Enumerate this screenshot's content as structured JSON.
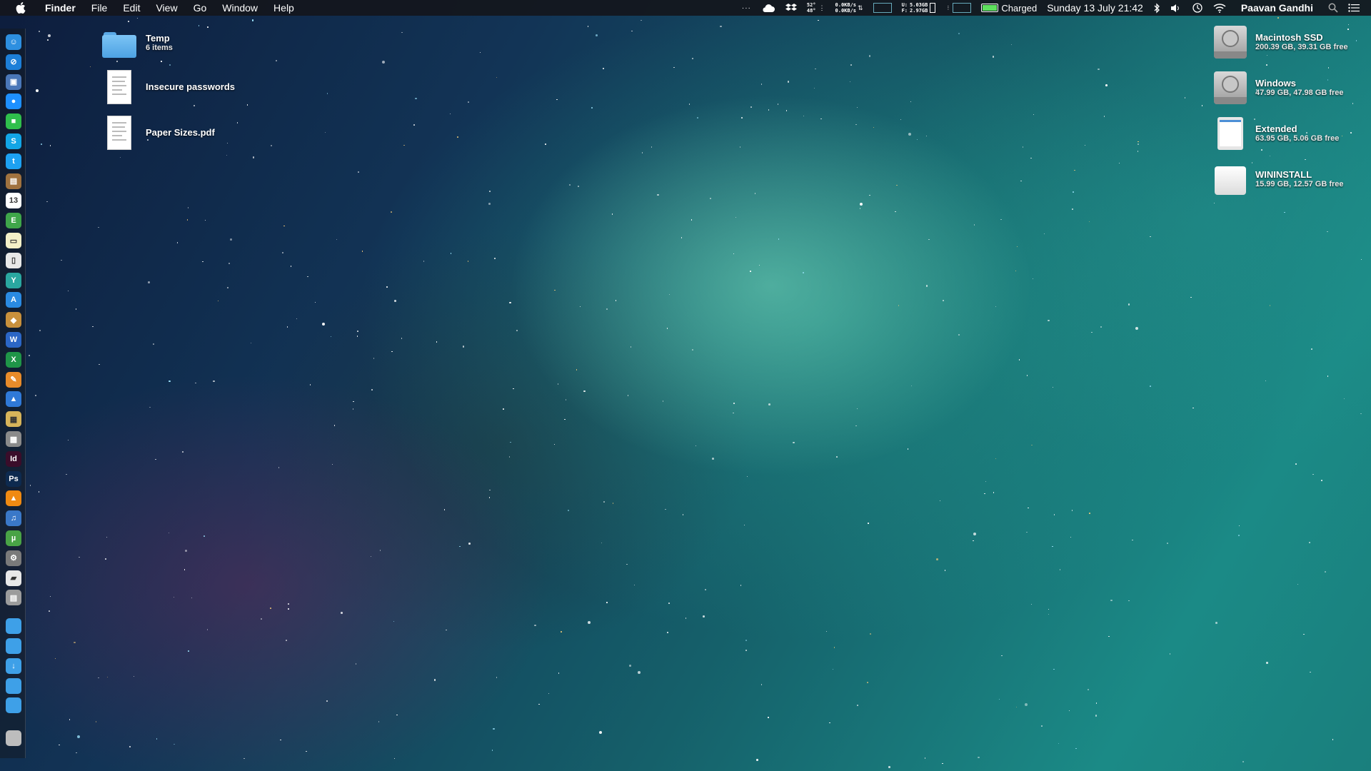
{
  "menubar": {
    "app_name": "Finder",
    "menus": [
      "File",
      "Edit",
      "View",
      "Go",
      "Window",
      "Help"
    ],
    "status": {
      "temp_top": "52°",
      "temp_bottom": "48°",
      "net_up": "0.0KB/s",
      "net_down": "0.0KB/s",
      "mem_used_label": "U:",
      "mem_free_label": "F:",
      "mem_used": "5.03GB",
      "mem_free": "2.97GB",
      "battery_text": "Charged",
      "clock": "Sunday 13 July 21:42",
      "user": "Paavan Gandhi"
    }
  },
  "desktop_left": [
    {
      "name": "Temp",
      "sub": "6 items",
      "kind": "folder"
    },
    {
      "name": "Insecure passwords",
      "sub": "",
      "kind": "document"
    },
    {
      "name": "Paper Sizes.pdf",
      "sub": "",
      "kind": "document"
    }
  ],
  "drives": [
    {
      "name": "Macintosh SSD",
      "sub": "200.39 GB, 39.31 GB free",
      "kind": "hdd"
    },
    {
      "name": "Windows",
      "sub": "47.99 GB, 47.98 GB free",
      "kind": "hdd"
    },
    {
      "name": "Extended",
      "sub": "63.95 GB, 5.06 GB free",
      "kind": "sdcard"
    },
    {
      "name": "WININSTALL",
      "sub": "15.99 GB, 12.57 GB free",
      "kind": "external"
    }
  ],
  "dock_icons": [
    {
      "name": "finder-icon",
      "glyph": "☺",
      "color": "#2d8fe0"
    },
    {
      "name": "safari-icon",
      "glyph": "⊘",
      "color": "#1d7fd8"
    },
    {
      "name": "preview-icon",
      "glyph": "▣",
      "color": "#4a77b8"
    },
    {
      "name": "messages-icon",
      "glyph": "●",
      "color": "#1e90ff"
    },
    {
      "name": "facetime-icon",
      "glyph": "■",
      "color": "#2fbf4c"
    },
    {
      "name": "skype-icon",
      "glyph": "S",
      "color": "#12a5e6"
    },
    {
      "name": "twitter-icon",
      "glyph": "t",
      "color": "#1da1f2"
    },
    {
      "name": "notebook-icon",
      "glyph": "▤",
      "color": "#a0723f"
    },
    {
      "name": "calendar-icon",
      "glyph": "13",
      "color": "#ffffff"
    },
    {
      "name": "evernote-icon",
      "glyph": "E",
      "color": "#3fa64a"
    },
    {
      "name": "notes-icon",
      "glyph": "▭",
      "color": "#f4f0c8"
    },
    {
      "name": "textedit-icon",
      "glyph": "▯",
      "color": "#e8e8e8"
    },
    {
      "name": "yoink-icon",
      "glyph": "Y",
      "color": "#2aa7a0"
    },
    {
      "name": "app-store-icon",
      "glyph": "A",
      "color": "#2a8ae2"
    },
    {
      "name": "package-icon",
      "glyph": "◆",
      "color": "#c8903c"
    },
    {
      "name": "word-icon",
      "glyph": "W",
      "color": "#2b66c6"
    },
    {
      "name": "excel-icon",
      "glyph": "X",
      "color": "#1f9548"
    },
    {
      "name": "pages-icon",
      "glyph": "✎",
      "color": "#e88b2a"
    },
    {
      "name": "keynote-icon",
      "glyph": "▲",
      "color": "#2f79d8"
    },
    {
      "name": "archive-icon",
      "glyph": "▦",
      "color": "#d7b45a"
    },
    {
      "name": "image-capture-icon",
      "glyph": "▩",
      "color": "#8a8a8a"
    },
    {
      "name": "indesign-icon",
      "glyph": "Id",
      "color": "#3a0d2a"
    },
    {
      "name": "photoshop-icon",
      "glyph": "Ps",
      "color": "#0d2a4f"
    },
    {
      "name": "vlc-icon",
      "glyph": "▲",
      "color": "#f08a12"
    },
    {
      "name": "itunes-icon",
      "glyph": "♫",
      "color": "#3a78c8"
    },
    {
      "name": "utorrent-icon",
      "glyph": "µ",
      "color": "#49a346"
    },
    {
      "name": "system-preferences-icon",
      "glyph": "⚙",
      "color": "#7a7a7a"
    },
    {
      "name": "script-icon",
      "glyph": "▰",
      "color": "#e8e8e8"
    },
    {
      "name": "printer-icon",
      "glyph": "▤",
      "color": "#9c9c9c"
    },
    {
      "name": "folder-applications-icon",
      "glyph": "",
      "color": "#3ea0e8"
    },
    {
      "name": "folder-documents-icon",
      "glyph": "",
      "color": "#3ea0e8"
    },
    {
      "name": "folder-downloads-icon",
      "glyph": "↓",
      "color": "#3ea0e8"
    },
    {
      "name": "folder-desktop-icon",
      "glyph": "",
      "color": "#3ea0e8"
    },
    {
      "name": "folder-pictures-icon",
      "glyph": "",
      "color": "#3ea0e8"
    },
    {
      "name": "trash-icon",
      "glyph": "",
      "color": "#bdbdbd"
    }
  ]
}
